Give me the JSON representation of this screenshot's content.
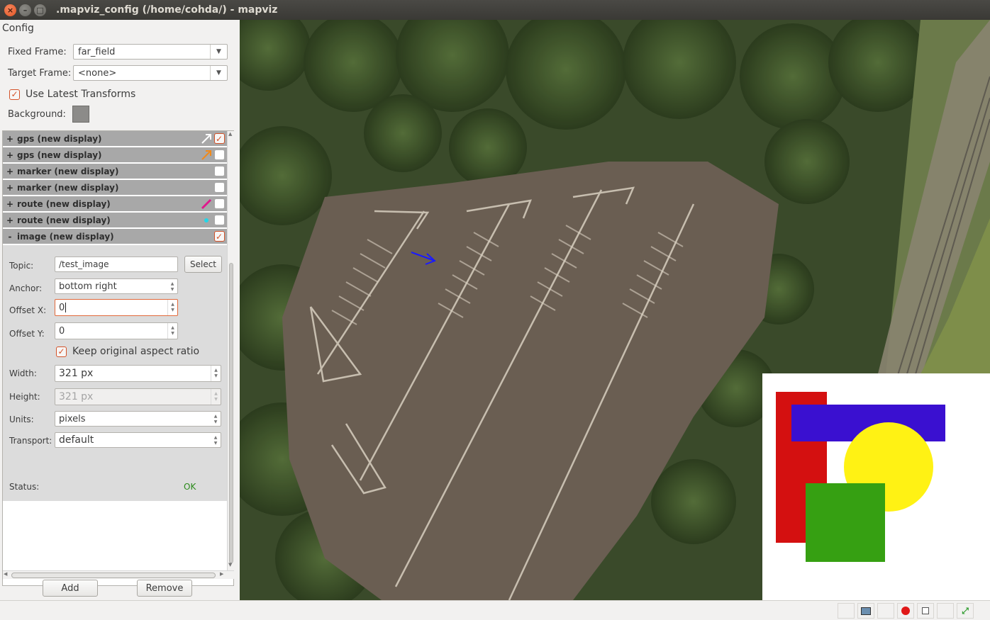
{
  "window": {
    "title": ".mapviz_config (/home/cohda/) - mapviz",
    "close_glyph": "×",
    "min_glyph": "–",
    "max_glyph": "□"
  },
  "config": {
    "title": "Config",
    "fixed_frame_label": "Fixed Frame:",
    "fixed_frame_value": "far_field",
    "target_frame_label": "Target Frame:",
    "target_frame_value": "<none>",
    "use_latest_transforms_label": "Use Latest Transforms",
    "use_latest_transforms_checked": true,
    "background_label": "Background:",
    "background_color": "#8c8b89"
  },
  "displays": [
    {
      "expander": "+",
      "name": "gps (new display)",
      "indicator": "arrow-icon",
      "indicator_color": "#ffffff",
      "checked": true
    },
    {
      "expander": "+",
      "name": "gps (new display)",
      "indicator": "arrow-icon",
      "indicator_color": "#f08a1c",
      "checked": false
    },
    {
      "expander": "+",
      "name": "marker (new display)",
      "indicator": "",
      "indicator_color": "",
      "checked": false
    },
    {
      "expander": "+",
      "name": "marker (new display)",
      "indicator": "",
      "indicator_color": "",
      "checked": false
    },
    {
      "expander": "+",
      "name": "route (new display)",
      "indicator": "line-icon",
      "indicator_color": "#e0178c",
      "checked": false
    },
    {
      "expander": "+",
      "name": "route (new display)",
      "indicator": "dot-icon",
      "indicator_color": "#23d6e8",
      "checked": false
    },
    {
      "expander": "-",
      "name": "image (new display)",
      "indicator": "",
      "indicator_color": "",
      "checked": true
    }
  ],
  "image_props": {
    "topic_label": "Topic:",
    "topic_value": "/test_image",
    "select_label": "Select",
    "anchor_label": "Anchor:",
    "anchor_value": "bottom right",
    "offset_x_label": "Offset X:",
    "offset_x_value": "0",
    "offset_y_label": "Offset Y:",
    "offset_y_value": "0",
    "keep_aspect_label": "Keep original aspect ratio",
    "keep_aspect_checked": true,
    "width_label": "Width:",
    "width_value": "321 px",
    "height_label": "Height:",
    "height_value": "321 px",
    "units_label": "Units:",
    "units_value": "pixels",
    "transport_label": "Transport:",
    "transport_value": "default",
    "status_label": "Status:",
    "status_value": "OK",
    "status_color": "#2a8a1a"
  },
  "buttons": {
    "add_label": "Add",
    "remove_label": "Remove"
  },
  "overlay_image": {
    "colors": {
      "red": "#d41010",
      "blue": "#3a10d0",
      "yellow": "#fff214",
      "green": "#36a012"
    }
  },
  "statusbar": {
    "icons": [
      "blank-icon",
      "screenshot-icon",
      "blank-icon",
      "record-icon",
      "stop-icon",
      "blank-icon",
      "fit-icon"
    ],
    "record_color": "#e01818"
  }
}
